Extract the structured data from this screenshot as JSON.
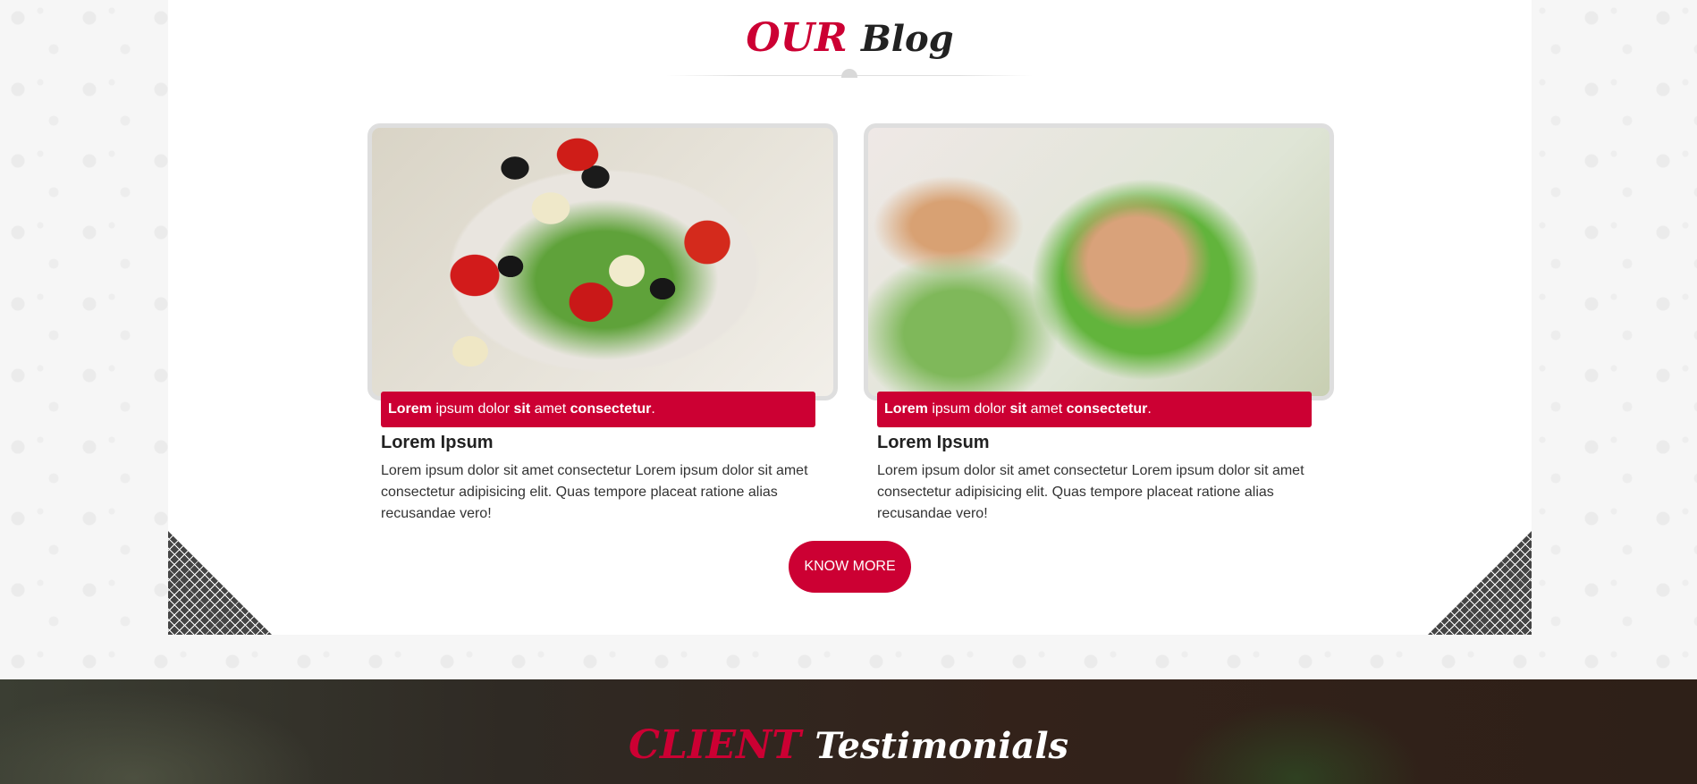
{
  "blog": {
    "title_accent": "OUR",
    "title_rest": "Blog",
    "cards": [
      {
        "image_alt": "Greek salad with tomatoes, olives, feta and cucumber",
        "caption_b1": "Lorem",
        "caption_t1": " ipsum dolor ",
        "caption_b2": "sit",
        "caption_t2": " amet ",
        "caption_b3": "consectetur",
        "caption_t3": ".",
        "heading": "Lorem Ipsum",
        "text": "Lorem ipsum dolor sit amet consectetur Lorem ipsum dolor sit amet consectetur adipisicing elit. Quas tempore placeat ratione alias recusandae vero!"
      },
      {
        "image_alt": "Grilled chicken on lettuce",
        "caption_b1": "Lorem",
        "caption_t1": " ipsum dolor ",
        "caption_b2": "sit",
        "caption_t2": " amet ",
        "caption_b3": "consectetur",
        "caption_t3": ".",
        "heading": "Lorem Ipsum",
        "text": "Lorem ipsum dolor sit amet consectetur Lorem ipsum dolor sit amet consectetur adipisicing elit. Quas tempore placeat ratione alias recusandae vero!"
      }
    ],
    "button_label": "KNOW MORE"
  },
  "testimonials": {
    "title_accent": "CLIENT",
    "title_rest": "Testimonials"
  },
  "colors": {
    "accent": "#cc0033",
    "panel": "#ffffff",
    "dark_band": "#2f2a24"
  }
}
